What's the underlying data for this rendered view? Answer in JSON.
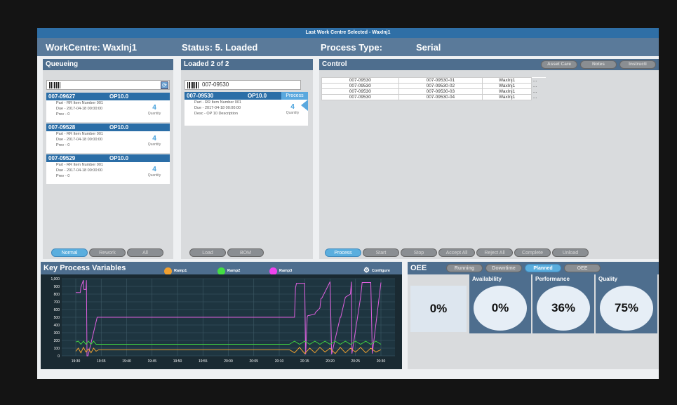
{
  "top_bar": "Last Work Centre Selected - WaxInj1",
  "header": {
    "workcentre": "WorkCentre: WaxInj1",
    "status": "Status: 5. Loaded",
    "process_type_label": "Process Type:",
    "process_type_value": "Serial"
  },
  "queueing": {
    "title": "Queueing",
    "search": "",
    "cards": [
      {
        "job": "007-09627",
        "op": "OP10.0",
        "part": "Part - RR Item Number 001",
        "due": "Due - 2017-04-18 00:00:00",
        "prev": "Prev - 0",
        "qty": "4",
        "qty_label": "Quantity"
      },
      {
        "job": "007-09528",
        "op": "OP10.0",
        "part": "Part - RR Item Number 001",
        "due": "Due - 2017-04-18 00:00:00",
        "prev": "Prev - 0",
        "qty": "4",
        "qty_label": "Quantity"
      },
      {
        "job": "007-09529",
        "op": "OP10.0",
        "part": "Part - RR Item Number 001",
        "due": "Due - 2017-04-18 00:00:00",
        "prev": "Prev - 0",
        "qty": "4",
        "qty_label": "Quantity"
      }
    ],
    "buttons": [
      "Normal",
      "Rework",
      "All"
    ]
  },
  "loaded": {
    "title": "Loaded  2  of  2",
    "search": "007-09530",
    "card": {
      "job": "007-09530",
      "op": "OP10.0",
      "tag": "Process",
      "part": "Part - RR Item Number 001",
      "due": "Due - 2017-04-18 00:00:00",
      "desc": "Desc - OP 10 Description",
      "qty": "4",
      "qty_label": "Quantity"
    },
    "buttons": [
      "Load",
      "BOM"
    ]
  },
  "control": {
    "title": "Control",
    "top_buttons": [
      "Asset Care",
      "Notes",
      "Instructi"
    ],
    "rows": [
      [
        "007-09530",
        "007-09530-01",
        "WaxInj1",
        "..."
      ],
      [
        "007-09530",
        "007-09530-02",
        "WaxInj1",
        "..."
      ],
      [
        "007-09530",
        "007-09530-03",
        "WaxInj1",
        "..."
      ],
      [
        "007-09530",
        "007-09530-04",
        "WaxInj1",
        "..."
      ]
    ],
    "bottom_buttons": [
      "Process",
      "Start",
      "Stop",
      "Accept All",
      "Reject All",
      "Complete",
      "Unload"
    ]
  },
  "kpv": {
    "title": "Key Process Variables",
    "legend": [
      {
        "name": "Ramp1",
        "color": "#f0a030"
      },
      {
        "name": "Ramp2",
        "color": "#44dd44"
      },
      {
        "name": "Ramp3",
        "color": "#ee44ee"
      }
    ],
    "configure": "Configure"
  },
  "chart_data": {
    "type": "line",
    "yticks": [
      "1,000",
      "900",
      "800",
      "700",
      "600",
      "500",
      "400",
      "300",
      "200",
      "100",
      "0"
    ],
    "xticks": [
      "19:30",
      "19:35",
      "19:40",
      "19:45",
      "19:50",
      "19:55",
      "20:00",
      "20:05",
      "20:10",
      "20:15",
      "20:20",
      "20:25",
      "20:30"
    ],
    "ylim": [
      0,
      1000
    ],
    "xlim": [
      0,
      60
    ],
    "grid": true,
    "series": [
      {
        "name": "Ramp3",
        "color": "#e060e0",
        "x": [
          0,
          0.9,
          1,
          1.5,
          1.6,
          2,
          2.1,
          2.2,
          2.3,
          2.4,
          4.2,
          43,
          43.2,
          43.4,
          43.6,
          45,
          45.2,
          45.5,
          45.6,
          47,
          47.1,
          48,
          48.2,
          48.4,
          50,
          50.3,
          52,
          52.1,
          53,
          53.5,
          54,
          54.2,
          54.3,
          56,
          56.3,
          58,
          58.3,
          60
        ],
        "y": [
          820,
          820,
          890,
          980,
          860,
          860,
          980,
          0,
          0,
          0,
          500,
          500,
          880,
          940,
          940,
          940,
          20,
          500,
          520,
          540,
          560,
          620,
          740,
          750,
          960,
          20,
          500,
          500,
          760,
          780,
          800,
          960,
          30,
          760,
          950,
          950,
          30,
          950
        ]
      },
      {
        "name": "Ramp2",
        "color": "#40d040",
        "x": [
          0,
          0.5,
          1,
          1.5,
          2,
          2.5,
          3,
          3.5,
          4,
          42,
          43,
          44,
          45,
          46,
          47,
          48,
          49,
          50,
          51,
          52,
          53,
          54,
          55,
          56,
          57,
          58,
          59,
          60
        ],
        "y": [
          180,
          190,
          150,
          190,
          150,
          190,
          150,
          190,
          150,
          150,
          190,
          150,
          190,
          150,
          190,
          150,
          190,
          150,
          190,
          150,
          190,
          150,
          190,
          150,
          190,
          150,
          190,
          150
        ]
      },
      {
        "name": "Ramp1",
        "color": "#f0a030",
        "x": [
          0,
          0.5,
          1,
          1.5,
          2,
          2.5,
          3,
          3.5,
          4,
          4.5,
          42,
          43,
          44,
          45,
          46,
          47,
          48,
          49,
          50,
          51,
          52,
          53,
          54,
          55,
          56,
          57,
          58,
          59,
          60
        ],
        "y": [
          60,
          100,
          40,
          110,
          50,
          90,
          40,
          100,
          60,
          80,
          80,
          40,
          110,
          30,
          100,
          40,
          110,
          50,
          100,
          30,
          110,
          40,
          100,
          50,
          110,
          40,
          100,
          50,
          80
        ]
      }
    ]
  },
  "oee": {
    "title": "OEE",
    "tabs": [
      "Running",
      "Downtime",
      "Planned",
      "OEE"
    ],
    "active_tab": "Planned",
    "oee_value": "0%",
    "metrics": [
      {
        "label": "Availability",
        "value": "0%"
      },
      {
        "label": "Performance",
        "value": "36%"
      },
      {
        "label": "Quality",
        "value": "75%"
      }
    ]
  }
}
